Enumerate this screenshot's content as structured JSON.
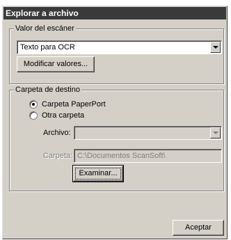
{
  "window": {
    "title": "Explorar a archivo"
  },
  "scanner": {
    "group_label": "Valor del escáner",
    "mode_value": "Texto para OCR",
    "modify_button": "Modificar valores..."
  },
  "destination": {
    "group_label": "Carpeta de destino",
    "radio_paperport": "Carpeta PaperPort",
    "radio_other": "Otra carpeta",
    "selected": "paperport",
    "file_label": "Archivo:",
    "file_value": "",
    "folder_label": "Carpeta:",
    "folder_value": "C:\\Documentos ScanSoft\\",
    "browse_button": "Examinar..."
  },
  "footer": {
    "accept_button": "Aceptar"
  }
}
